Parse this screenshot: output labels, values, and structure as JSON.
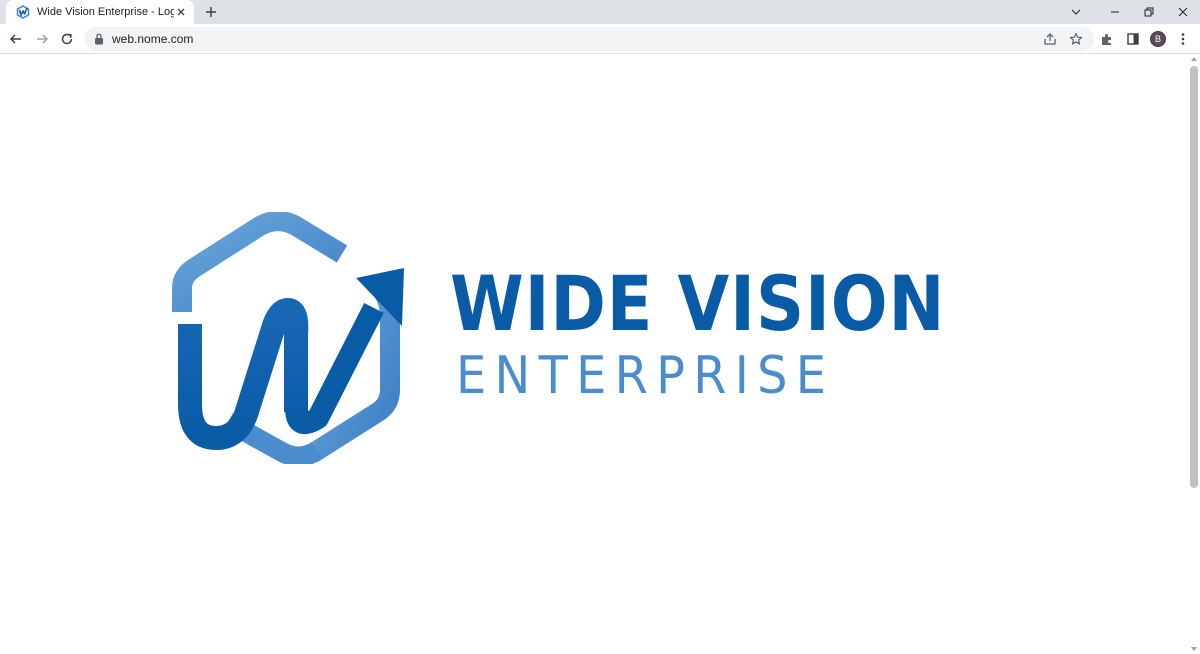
{
  "browser": {
    "tab": {
      "title": "Wide Vision Enterprise - Logo",
      "favicon": "wv-logo-icon"
    },
    "address_bar": {
      "url": "web.nome.com",
      "lock_icon": "lock-icon"
    },
    "profile_initial": "B",
    "icons": {
      "back": "arrow-left-icon",
      "forward": "arrow-right-icon",
      "reload": "reload-icon",
      "share": "share-icon",
      "bookmark": "star-icon",
      "extensions": "puzzle-icon",
      "side_panel": "side-panel-icon",
      "menu": "kebab-menu-icon",
      "new_tab": "plus-icon",
      "tab_search": "chevron-down-icon",
      "minimize": "minimize-icon",
      "restore": "restore-icon",
      "close": "close-icon"
    }
  },
  "page": {
    "logo": {
      "line1": "WIDE VISION",
      "line2": "ENTERPRISE",
      "colors": {
        "primary": "#0a5ba6",
        "secondary": "#4a8ccc",
        "hexagon_light": "#6aa6dc"
      }
    }
  }
}
